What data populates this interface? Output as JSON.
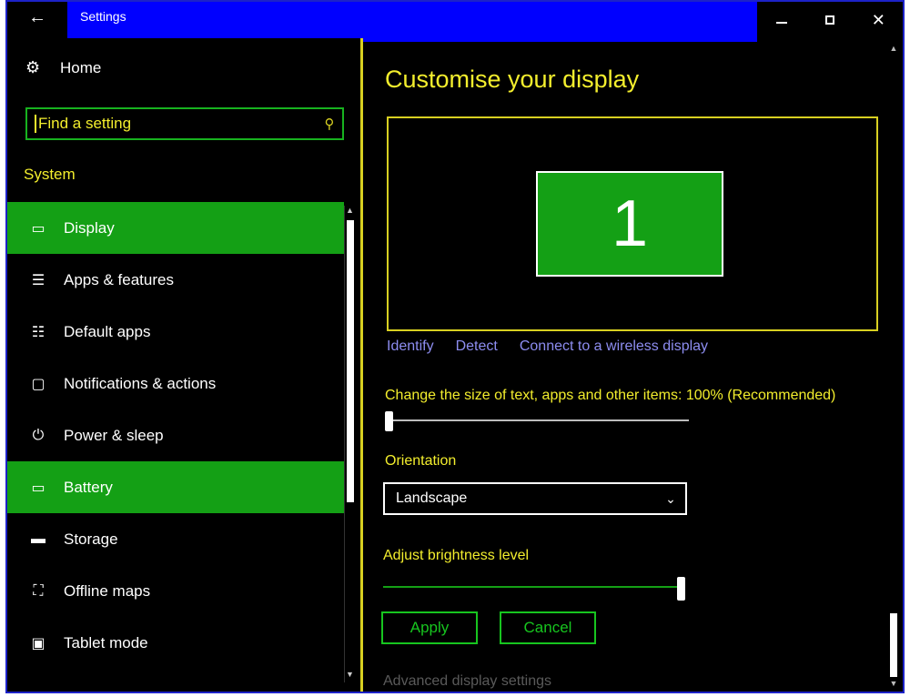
{
  "window": {
    "title": "Settings",
    "back_glyph": "←",
    "controls": {
      "minimize": "minimize",
      "maximize": "maximize",
      "close": "✕"
    }
  },
  "sidebar": {
    "home_label": "Home",
    "home_icon": "gear-icon",
    "search": {
      "value": "Find a setting",
      "icon": "search-icon"
    },
    "section": "System",
    "items": [
      {
        "label": "Display",
        "icon": "monitor-icon",
        "glyph": "▭",
        "active": true
      },
      {
        "label": "Apps & features",
        "icon": "list-icon",
        "glyph": "☰",
        "active": false
      },
      {
        "label": "Default apps",
        "icon": "default-apps-icon",
        "glyph": "☷",
        "active": false
      },
      {
        "label": "Notifications & actions",
        "icon": "speech-bubble-icon",
        "glyph": "▢",
        "active": false
      },
      {
        "label": "Power & sleep",
        "icon": "power-icon",
        "glyph": "⏻",
        "active": false
      },
      {
        "label": "Battery",
        "icon": "battery-icon",
        "glyph": "▭",
        "active": true
      },
      {
        "label": "Storage",
        "icon": "storage-icon",
        "glyph": "▬",
        "active": false
      },
      {
        "label": "Offline maps",
        "icon": "map-icon",
        "glyph": "⛶",
        "active": false
      },
      {
        "label": "Tablet mode",
        "icon": "tablet-icon",
        "glyph": "▣",
        "active": false
      }
    ]
  },
  "main": {
    "title": "Customise your display",
    "monitor_number": "1",
    "links": {
      "identify": "Identify",
      "detect": "Detect",
      "wireless": "Connect to a wireless display"
    },
    "scale_label": "Change the size of text, apps and other items: 100% (Recommended)",
    "scale_level": 0.0,
    "orientation_label": "Orientation",
    "orientation_value": "Landscape",
    "brightness_label": "Adjust brightness level",
    "brightness_level": 1.0,
    "apply_label": "Apply",
    "cancel_label": "Cancel",
    "advanced_label": "Advanced display settings"
  },
  "colors": {
    "accent_green": "#14a015",
    "text_yellow": "#f3ee2d",
    "link_blue": "#8d8df0",
    "titlebar_blue": "#0000ff"
  }
}
